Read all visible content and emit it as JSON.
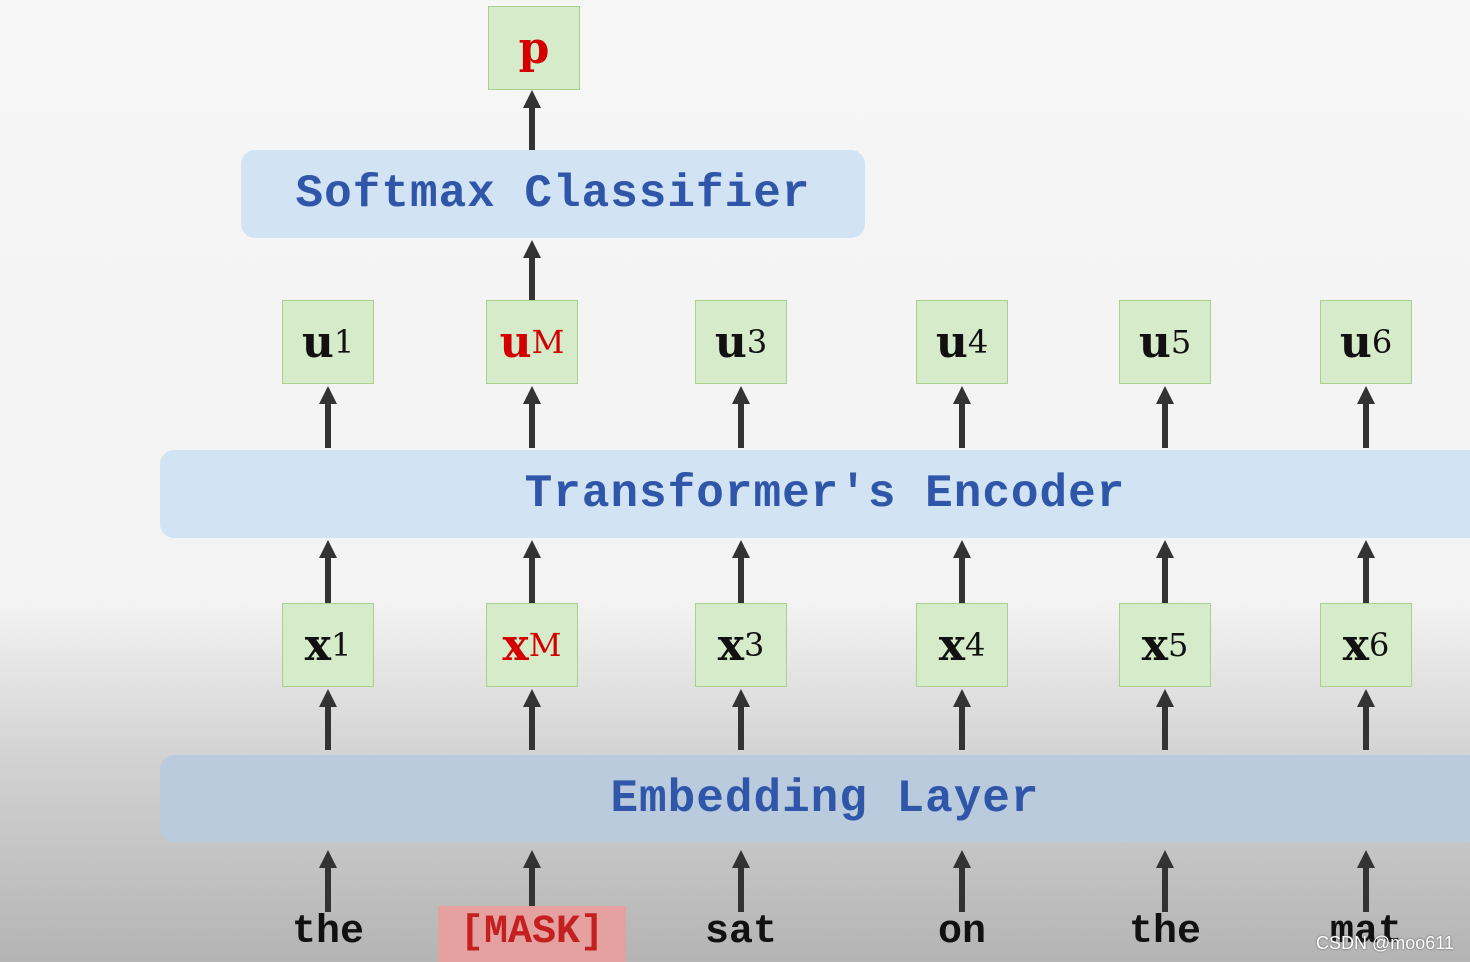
{
  "output": {
    "label": "p",
    "color": "#d40000"
  },
  "softmax": {
    "label": "Softmax Classifier"
  },
  "encoder": {
    "label": "Transformer's Encoder"
  },
  "embedding": {
    "label": "Embedding Layer"
  },
  "outputs": [
    {
      "base": "u",
      "sub": "1",
      "masked": false
    },
    {
      "base": "u",
      "sub": "M",
      "masked": true
    },
    {
      "base": "u",
      "sub": "3",
      "masked": false
    },
    {
      "base": "u",
      "sub": "4",
      "masked": false
    },
    {
      "base": "u",
      "sub": "5",
      "masked": false
    },
    {
      "base": "u",
      "sub": "6",
      "masked": false
    }
  ],
  "inputs": [
    {
      "base": "x",
      "sub": "1",
      "masked": false
    },
    {
      "base": "x",
      "sub": "M",
      "masked": true
    },
    {
      "base": "x",
      "sub": "3",
      "masked": false
    },
    {
      "base": "x",
      "sub": "4",
      "masked": false
    },
    {
      "base": "x",
      "sub": "5",
      "masked": false
    },
    {
      "base": "x",
      "sub": "6",
      "masked": false
    }
  ],
  "words": [
    {
      "text": "the",
      "masked": false
    },
    {
      "text": "[MASK]",
      "masked": true
    },
    {
      "text": "sat",
      "masked": false
    },
    {
      "text": "on",
      "masked": false
    },
    {
      "text": "the",
      "masked": false
    },
    {
      "text": "mat",
      "masked": false
    }
  ],
  "watermark": "CSDN @moo611",
  "colors": {
    "box_fill": "#d6ebc9",
    "band_blue": "#d2e3f3",
    "band_text": "#2f56a8",
    "mask": "#d40000"
  }
}
